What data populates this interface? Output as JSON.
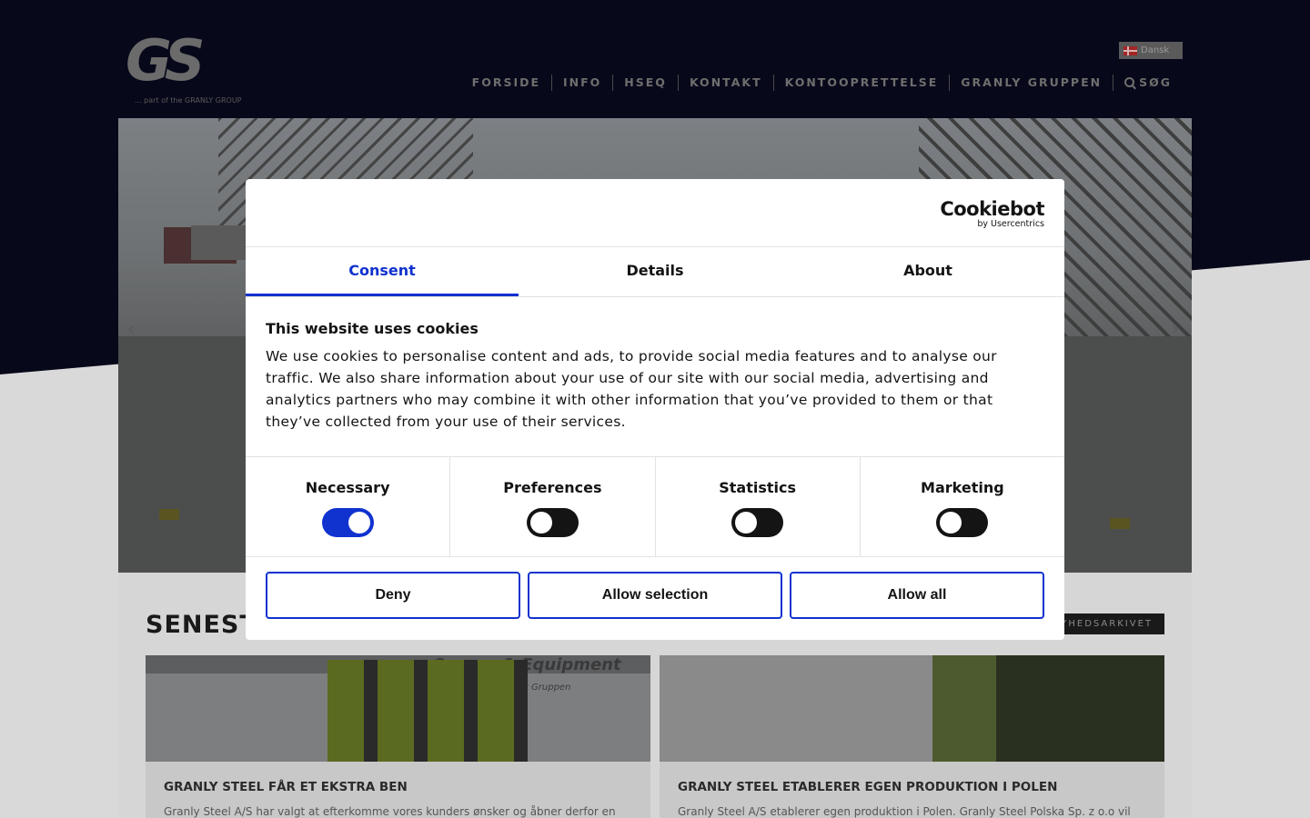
{
  "site": {
    "logo_text": "GS",
    "logo_tagline": "... part of the GRANLY GROUP",
    "language": "Dansk",
    "nav": [
      {
        "label": "FORSIDE"
      },
      {
        "label": "INFO"
      },
      {
        "label": "HSEQ"
      },
      {
        "label": "KONTAKT"
      },
      {
        "label": "KONTOOPRETTELSE"
      },
      {
        "label": "GRANLY GRUPPEN"
      },
      {
        "label": "SØG",
        "icon": "search-icon"
      }
    ],
    "hero_prev": "‹",
    "hero_next": "›"
  },
  "news": {
    "title": "SENEST",
    "archive_label": "YHEDSARKIVET",
    "cards": [
      {
        "title": "GRANLY STEEL FÅR ET EKSTRA BEN",
        "text": "Granly Steel A/S har valgt at efterkomme vores kunders ønsker og åbner derfor en",
        "image_text": "Cranes & Equipment",
        "image_subtext": "of Granly Gruppen"
      },
      {
        "title": "GRANLY STEEL ETABLERER EGEN PRODUKTION I POLEN",
        "text": "Granly Steel A/S etablerer egen produktion i Polen. Granly Steel Polska Sp. z o.o vil"
      }
    ]
  },
  "cookie_dialog": {
    "brand": "Cookiebot",
    "brand_sub": "by Usercentrics",
    "tabs": [
      {
        "label": "Consent",
        "active": true
      },
      {
        "label": "Details",
        "active": false
      },
      {
        "label": "About",
        "active": false
      }
    ],
    "heading": "This website uses cookies",
    "body": "We use cookies to personalise content and ads, to provide social media features and to analyse our traffic. We also share information about your use of our site with our social media, advertising and analytics partners who may combine it with other information that you’ve provided to them or that they’ve collected from your use of their services.",
    "categories": [
      {
        "label": "Necessary",
        "enabled": true
      },
      {
        "label": "Preferences",
        "enabled": false
      },
      {
        "label": "Statistics",
        "enabled": false
      },
      {
        "label": "Marketing",
        "enabled": false
      }
    ],
    "buttons": {
      "deny": "Deny",
      "allow_selection": "Allow selection",
      "allow_all": "Allow all"
    }
  },
  "colors": {
    "header_bg": "#07081a",
    "accent": "#1032cf",
    "page_bg": "#d8d8d8"
  }
}
